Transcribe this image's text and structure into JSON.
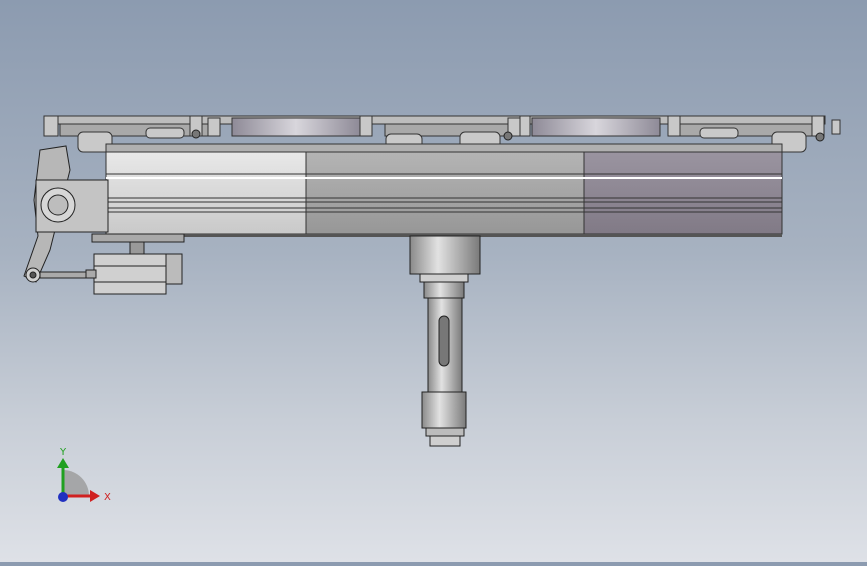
{
  "viewport": {
    "background_top": "#8c9bb0",
    "background_bottom": "#dee1e7"
  },
  "model": {
    "frame_colors": {
      "light": "#d6d6d6",
      "mid": "#a4a4a4",
      "dark": "#8d8790",
      "edge": "#3a3a3a",
      "top_plate": "#c4c4c4",
      "disc": "#7d7a86"
    }
  },
  "triad": {
    "axis_y_label": "Y",
    "axis_x_label": "X",
    "axis_y_color": "#20a020",
    "axis_x_color": "#d02020",
    "axis_z_color": "#2030c0",
    "icons": [
      "view-triad-icon"
    ]
  }
}
